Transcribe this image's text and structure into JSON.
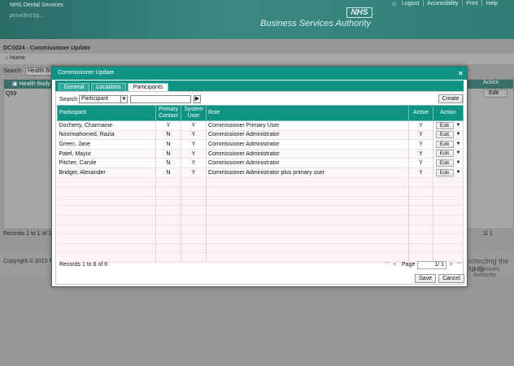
{
  "background": {
    "brand_top": "NHS Dental Services",
    "brand_tagline": "provided by...",
    "nhs_logo": "NHS",
    "bsa_title": "Business Services Authority",
    "top_links": [
      "Logout",
      "Accessibility",
      "Print",
      "Help"
    ],
    "page_title": "DCS024 - Commissioner Update",
    "home_label": "Home",
    "search_label": "Search",
    "search_value": "Health Bo",
    "grid_header": "Health Body C",
    "grid_row_value": "Q59",
    "action_header": "Action",
    "action_edit": "Edit",
    "records": "Records 1 to 1 of 1",
    "pager": "1/ 1",
    "copyright": "Copyright © 2015 N",
    "protect_text": "rotecting the NHS",
    "protect_text2": "s Services Authority"
  },
  "modal": {
    "title": "Commissioner Update",
    "close_glyph": "×",
    "tabs": [
      {
        "label": "General"
      },
      {
        "label": "Locations"
      },
      {
        "label": "Participants"
      }
    ],
    "active_tab": "Participants",
    "search": {
      "label": "Search",
      "field_value": "Participant",
      "input_value": "",
      "go_glyph": "▶"
    },
    "create_label": "Create",
    "columns": {
      "participant": "Participant",
      "primary_contact": "Primary Contact",
      "system_user": "System User",
      "role": "Role",
      "active": "Active",
      "action": "Action"
    },
    "rows": [
      {
        "participant": "Docherty, Charmaine",
        "primary": "Y",
        "system": "Y",
        "role": "Commissioner Primary User",
        "active": "Y",
        "action": "Edit"
      },
      {
        "participant": "Noormahomed, Razia",
        "primary": "N",
        "system": "Y",
        "role": "Commissioner Administrator",
        "active": "Y",
        "action": "Edit"
      },
      {
        "participant": "Green, Jane",
        "primary": "N",
        "system": "Y",
        "role": "Commissioner Administrator",
        "active": "Y",
        "action": "Edit"
      },
      {
        "participant": "Patel, Mayur",
        "primary": "N",
        "system": "Y",
        "role": "Commissioner Administrator",
        "active": "Y",
        "action": "Edit"
      },
      {
        "participant": "Pitcher, Carole",
        "primary": "N",
        "system": "Y",
        "role": "Commissioner Administrator",
        "active": "Y",
        "action": "Edit"
      },
      {
        "participant": "Bridger, Alexander",
        "primary": "N",
        "system": "Y",
        "role": "Commissioner Administrator plus primary user",
        "active": "Y",
        "action": "Edit"
      }
    ],
    "records_text": "Records 1 to 6 of 6",
    "pager": {
      "label": "Page",
      "current": "1",
      "total": "1/ 1"
    },
    "save_label": "Save",
    "cancel_label": "Cancel"
  }
}
